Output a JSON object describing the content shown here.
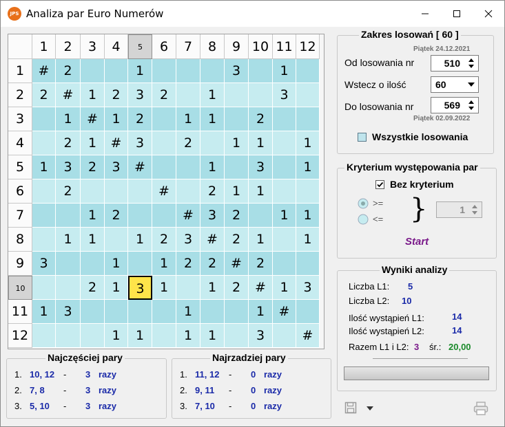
{
  "window": {
    "title": "Analiza par Euro Numerów",
    "icon_text": "JPS"
  },
  "grid": {
    "col_headers": [
      "1",
      "2",
      "3",
      "4",
      "5",
      "6",
      "7",
      "8",
      "9",
      "10",
      "11",
      "12"
    ],
    "row_headers": [
      "1",
      "2",
      "3",
      "4",
      "5",
      "6",
      "7",
      "8",
      "9",
      "10",
      "11",
      "12"
    ],
    "selected_col": 5,
    "selected_row": 10,
    "highlight_cell": {
      "row": 10,
      "col": 5
    },
    "rows": [
      [
        "#",
        "2",
        "",
        "",
        "1",
        "",
        "",
        "",
        "3",
        "",
        "1",
        ""
      ],
      [
        "2",
        "#",
        "1",
        "2",
        "3",
        "2",
        "",
        "1",
        "",
        "",
        "3",
        ""
      ],
      [
        "",
        "1",
        "#",
        "1",
        "2",
        "",
        "1",
        "1",
        "",
        "2",
        "",
        ""
      ],
      [
        "",
        "2",
        "1",
        "#",
        "3",
        "",
        "2",
        "",
        "1",
        "1",
        "",
        "1"
      ],
      [
        "1",
        "3",
        "2",
        "3",
        "#",
        "",
        "",
        "1",
        "",
        "3",
        "",
        "1"
      ],
      [
        "",
        "2",
        "",
        "",
        "",
        "#",
        "",
        "2",
        "1",
        "1",
        "",
        ""
      ],
      [
        "",
        "",
        "1",
        "2",
        "",
        "",
        "#",
        "3",
        "2",
        "",
        "1",
        "1"
      ],
      [
        "",
        "1",
        "1",
        "",
        "1",
        "2",
        "3",
        "#",
        "2",
        "1",
        "",
        "1"
      ],
      [
        "3",
        "",
        "",
        "1",
        "",
        "1",
        "2",
        "2",
        "#",
        "2",
        "",
        ""
      ],
      [
        "",
        "",
        "2",
        "1",
        "3",
        "1",
        "",
        "1",
        "2",
        "#",
        "1",
        "3"
      ],
      [
        "1",
        "3",
        "",
        "",
        "",
        "",
        "1",
        "",
        "",
        "1",
        "#",
        ""
      ],
      [
        "",
        "",
        "",
        "1",
        "1",
        "",
        "1",
        "1",
        "",
        "3",
        "",
        "#"
      ]
    ]
  },
  "range": {
    "title": "Zakres losowań  [ 60 ]",
    "date_from": "Piątek 24.12.2021",
    "from_label": "Od losowania nr",
    "from_value": "510",
    "back_label": "Wstecz o ilość",
    "back_value": "60",
    "to_label": "Do losowania nr",
    "to_value": "569",
    "date_to": "Piątek 02.09.2022",
    "all_label": "Wszystkie losowania",
    "all_checked": false
  },
  "criterion": {
    "title": "Kryterium występowania par",
    "none_label": "Bez kryterium",
    "none_checked": true,
    "ge_label": ">=",
    "le_label": "<=",
    "brace": "}",
    "value": "1",
    "start_label": "Start"
  },
  "results": {
    "title": "Wyniki analizy",
    "l1_label": "Liczba L1:",
    "l1_value": "5",
    "l2_label": "Liczba L2:",
    "l2_value": "10",
    "occ1_label": "Ilość wystąpień L1:",
    "occ1_value": "14",
    "occ2_label": "Ilość wystąpień L2:",
    "occ2_value": "14",
    "sum_label": "Razem L1 i L2:",
    "sum_value": "3",
    "avg_label": "śr.:",
    "avg_value": "20,00",
    "colors": {
      "sum": "#7a1a8a",
      "avg": "#1a8a2a",
      "blue": "#1a2aa8"
    }
  },
  "frequent": {
    "title": "Najczęściej pary",
    "items": [
      {
        "num": "1.",
        "pair": "10, 12",
        "dash": "-",
        "count": "3",
        "unit": "razy"
      },
      {
        "num": "2.",
        "pair": "7, 8",
        "dash": "-",
        "count": "3",
        "unit": "razy"
      },
      {
        "num": "3.",
        "pair": "5, 10",
        "dash": "-",
        "count": "3",
        "unit": "razy"
      }
    ]
  },
  "rare": {
    "title": "Najrzadziej pary",
    "items": [
      {
        "num": "1.",
        "pair": "11, 12",
        "dash": "-",
        "count": "0",
        "unit": "razy"
      },
      {
        "num": "2.",
        "pair": "9, 11",
        "dash": "-",
        "count": "0",
        "unit": "razy"
      },
      {
        "num": "3.",
        "pair": "7, 10",
        "dash": "-",
        "count": "0",
        "unit": "razy"
      }
    ]
  },
  "toolbar": {
    "save_icon": "save-icon",
    "dropdown_icon": "chevron-down-icon",
    "print_icon": "printer-icon"
  }
}
